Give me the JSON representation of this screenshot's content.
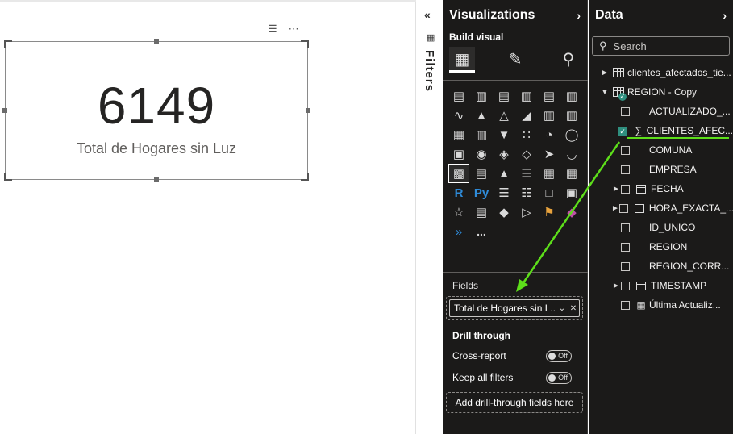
{
  "card": {
    "value": "6149",
    "label": "Total de Hogares sin Luz",
    "filter_icon": "filter-icon",
    "more_icon": "more-options-icon"
  },
  "filters": {
    "label": "Filters"
  },
  "visualizations": {
    "title": "Visualizations",
    "build_visual": "Build visual",
    "fields_label": "Fields",
    "field_pill": "Total de Hogares sin L...",
    "drill_title": "Drill through",
    "cross_report": "Cross-report",
    "cross_report_state": "Off",
    "keep_filters": "Keep all filters",
    "keep_filters_state": "Off",
    "add_drill": "Add drill-through fields here",
    "more": "..."
  },
  "data_pane": {
    "title": "Data",
    "search_placeholder": "Search",
    "tables": [
      {
        "name": "clientes_afectados_tie..."
      },
      {
        "name": "REGION - Copy"
      }
    ],
    "fields": [
      {
        "name": "ACTUALIZADO_...",
        "checked": false,
        "type": "none",
        "expandable": false
      },
      {
        "name": "CLIENTES_AFEC...",
        "checked": true,
        "type": "sigma",
        "expandable": false
      },
      {
        "name": "COMUNA",
        "checked": false,
        "type": "none",
        "expandable": false
      },
      {
        "name": "EMPRESA",
        "checked": false,
        "type": "none",
        "expandable": false
      },
      {
        "name": "FECHA",
        "checked": false,
        "type": "calendar",
        "expandable": true
      },
      {
        "name": "HORA_EXACTA_...",
        "checked": false,
        "type": "calendar",
        "expandable": true
      },
      {
        "name": "ID_UNICO",
        "checked": false,
        "type": "none",
        "expandable": false
      },
      {
        "name": "REGION",
        "checked": false,
        "type": "none",
        "expandable": false
      },
      {
        "name": "REGION_CORR...",
        "checked": false,
        "type": "none",
        "expandable": false
      },
      {
        "name": "TIMESTAMP",
        "checked": false,
        "type": "calendar",
        "expandable": true
      },
      {
        "name": "Última Actualiz...",
        "checked": false,
        "type": "calculator",
        "expandable": false
      }
    ]
  },
  "colors": {
    "pane_bg": "#1b1a19",
    "accent_green": "#5dde1a",
    "check_teal": "#2f8f7f"
  }
}
